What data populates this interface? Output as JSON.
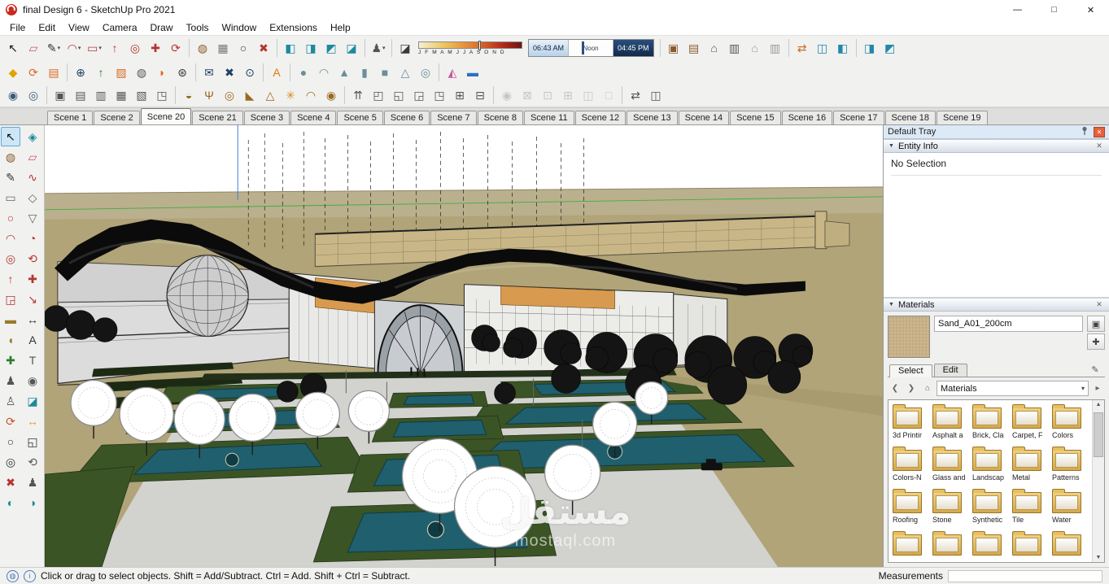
{
  "window": {
    "title": "final Design 6 - SketchUp Pro 2021",
    "controls": {
      "minimize": "—",
      "maximize": "□",
      "close": "✕"
    }
  },
  "menu": {
    "items": [
      "File",
      "Edit",
      "View",
      "Camera",
      "Draw",
      "Tools",
      "Window",
      "Extensions",
      "Help"
    ]
  },
  "toolbars": {
    "shadow": {
      "months": "J F M A M J J A S O N D",
      "time_start": "06:43 AM",
      "time_mid": "Noon",
      "time_end": "04:45 PM"
    },
    "row1a": [
      {
        "n": "select-tool",
        "g": "↖",
        "c": "#111111"
      },
      {
        "n": "eraser-tool",
        "g": "▱",
        "c": "#c4566a"
      },
      {
        "n": "line-tool",
        "g": "✎",
        "c": "#333333",
        "d": 1
      },
      {
        "n": "arc-tool",
        "g": "◠",
        "c": "#b5352f",
        "d": 1
      },
      {
        "n": "rectangle-tool",
        "g": "▭",
        "c": "#b5352f",
        "d": 1
      },
      {
        "n": "push-pull-tool",
        "g": "↑",
        "c": "#b5352f"
      },
      {
        "n": "offset-tool",
        "g": "◎",
        "c": "#b5352f"
      },
      {
        "n": "move-tool",
        "g": "✚",
        "c": "#b5352f"
      },
      {
        "n": "rotate-tool",
        "g": "⟳",
        "c": "#b5352f"
      },
      {
        "sep": 1
      },
      {
        "n": "paint-bucket-tool",
        "g": "◍",
        "c": "#8a5a2a"
      },
      {
        "n": "sandbox-tool",
        "g": "▦",
        "c": "#777777"
      },
      {
        "n": "zoom-tool",
        "g": "○",
        "c": "#333333"
      },
      {
        "n": "axes-tool",
        "g": "✖",
        "c": "#b5352f"
      },
      {
        "sep": 1
      },
      {
        "n": "section-plane-tool",
        "g": "◧",
        "c": "#1b8a9e"
      },
      {
        "n": "section-fill-toggle",
        "g": "◨",
        "c": "#1b8a9e"
      },
      {
        "n": "section-display-toggle",
        "g": "◩",
        "c": "#1b8a9e"
      },
      {
        "n": "section-cuts-toggle",
        "g": "◪",
        "c": "#1b8a9e"
      },
      {
        "sep": 1
      },
      {
        "n": "walk-tool",
        "g": "♟",
        "c": "#555555",
        "d": 1
      },
      {
        "sep": 1
      },
      {
        "n": "shadows-toggle",
        "g": "◪",
        "c": "#3a3a3a"
      }
    ],
    "row1b": [
      {
        "sep": 1
      },
      {
        "n": "components-browser",
        "g": "▣",
        "c": "#8a5a2a"
      },
      {
        "n": "styles-browser",
        "g": "▤",
        "c": "#8a5a2a"
      },
      {
        "n": "model-home",
        "g": "⌂",
        "c": "#555555"
      },
      {
        "n": "print-model",
        "g": "▥",
        "c": "#555555"
      },
      {
        "n": "home-outline",
        "g": "⌂",
        "c": "#999999"
      },
      {
        "n": "print-outline",
        "g": "▥",
        "c": "#999999"
      },
      {
        "sep": 1
      },
      {
        "n": "import-export",
        "g": "⇄",
        "c": "#c96a1f"
      },
      {
        "n": "xray-mode",
        "g": "◫",
        "c": "#2187a8"
      },
      {
        "n": "back-edges-mode",
        "g": "◧",
        "c": "#2187a8"
      },
      {
        "sep": 1
      },
      {
        "n": "wireframe-mode",
        "g": "◨",
        "c": "#2187a8"
      },
      {
        "n": "shaded-mode",
        "g": "◩",
        "c": "#2187a8"
      }
    ],
    "row2": [
      {
        "n": "extension-warehouse",
        "g": "◆",
        "c": "#e0a400"
      },
      {
        "n": "refresh-style",
        "g": "⟳",
        "c": "#d96b1f"
      },
      {
        "n": "layers-manager",
        "g": "▤",
        "c": "#d96b1f"
      },
      {
        "sep": 1
      },
      {
        "n": "add-location",
        "g": "⊕",
        "c": "#1c3f66"
      },
      {
        "n": "send-to-layout",
        "g": "↑",
        "c": "#2d7d2d"
      },
      {
        "n": "photo-textures",
        "g": "▨",
        "c": "#d96b1f"
      },
      {
        "n": "advanced-camera",
        "g": "◍",
        "c": "#555555"
      },
      {
        "n": "solid-tools",
        "g": "◗",
        "c": "#d96b1f"
      },
      {
        "n": "settings-gear",
        "g": "⊛",
        "c": "#333333"
      },
      {
        "sep": 1
      },
      {
        "n": "send-mail",
        "g": "✉",
        "c": "#1c3f66"
      },
      {
        "n": "close-tool",
        "g": "✖",
        "c": "#1c3f66"
      },
      {
        "n": "info-tool",
        "g": "⊙",
        "c": "#1c3f66"
      },
      {
        "sep": 1
      },
      {
        "n": "artisan-tools",
        "g": "A",
        "c": "#e07b10"
      },
      {
        "sep": 1
      },
      {
        "n": "shape-sphere",
        "g": "●",
        "c": "#6a8f98"
      },
      {
        "n": "shape-dome",
        "g": "◠",
        "c": "#6a8f98"
      },
      {
        "n": "shape-cone",
        "g": "▲",
        "c": "#6a8f98"
      },
      {
        "n": "shape-cylinder",
        "g": "▮",
        "c": "#6a8f98"
      },
      {
        "n": "shape-box",
        "g": "■",
        "c": "#6a8f98"
      },
      {
        "n": "shape-pyramid",
        "g": "△",
        "c": "#6a8f98"
      },
      {
        "n": "shape-torus",
        "g": "◎",
        "c": "#6a8f98"
      },
      {
        "sep": 1
      },
      {
        "n": "mirror-tool",
        "g": "◭",
        "c": "#c55a9e"
      },
      {
        "n": "flatten-tool",
        "g": "▬",
        "c": "#2d6fc2"
      }
    ],
    "row3": [
      {
        "n": "round-corner-tool",
        "g": "◉",
        "c": "#3a5a7a"
      },
      {
        "n": "round-edge-tool",
        "g": "◎",
        "c": "#3a5a7a"
      },
      {
        "sep": 1
      },
      {
        "n": "soften-edges-tool",
        "g": "▣",
        "c": "#555555"
      },
      {
        "n": "smooth-mesh-tool",
        "g": "▤",
        "c": "#555555"
      },
      {
        "n": "subdivide-tool",
        "g": "▥",
        "c": "#555555"
      },
      {
        "n": "quad-face-tool",
        "g": "▦",
        "c": "#555555"
      },
      {
        "n": "grid-tool",
        "g": "▧",
        "c": "#555555"
      },
      {
        "n": "box-corner-tool",
        "g": "◳",
        "c": "#555555"
      },
      {
        "sep": 1
      },
      {
        "n": "lamp-tool",
        "g": "◒",
        "c": "#9a6a1f"
      },
      {
        "n": "goblet-tool",
        "g": "Ψ",
        "c": "#9a6a1f"
      },
      {
        "n": "ring-tool",
        "g": "◎",
        "c": "#9a6a1f"
      },
      {
        "n": "triangle-ruler-tool",
        "g": "◣",
        "c": "#9a6a1f"
      },
      {
        "n": "tent-tool",
        "g": "△",
        "c": "#9a6a1f"
      },
      {
        "n": "sun-tool",
        "g": "✳",
        "c": "#d98a1f"
      },
      {
        "n": "dome-tool",
        "g": "◠",
        "c": "#9a6a1f"
      },
      {
        "n": "target-tool",
        "g": "◉",
        "c": "#9a6a1f"
      },
      {
        "sep": 1
      },
      {
        "n": "joint-push-pull",
        "g": "⇈",
        "c": "#555555"
      },
      {
        "n": "cube-cut-top",
        "g": "◰",
        "c": "#555555"
      },
      {
        "n": "cube-cut-bottom",
        "g": "◱",
        "c": "#555555"
      },
      {
        "n": "cube-cut-right",
        "g": "◲",
        "c": "#555555"
      },
      {
        "n": "cube-cut-left",
        "g": "◳",
        "c": "#555555"
      },
      {
        "n": "cube-grid-tool",
        "g": "⊞",
        "c": "#555555"
      },
      {
        "n": "cube-slice-tool",
        "g": "⊟",
        "c": "#555555"
      },
      {
        "sep": 1
      },
      {
        "n": "selection-zoom",
        "g": "◉",
        "c": "#888888",
        "x": 1
      },
      {
        "n": "selection-marquee",
        "g": "⊠",
        "c": "#888888",
        "x": 1
      },
      {
        "n": "selection-fill",
        "g": "⊡",
        "c": "#888888",
        "x": 1
      },
      {
        "n": "selection-grow",
        "g": "⊞",
        "c": "#888888",
        "x": 1
      },
      {
        "n": "selection-pane",
        "g": "◫",
        "c": "#888888",
        "x": 1
      },
      {
        "n": "selection-clear",
        "g": "□",
        "c": "#888888",
        "x": 1
      },
      {
        "sep": 1
      },
      {
        "n": "export-scene",
        "g": "⇄",
        "c": "#555555"
      },
      {
        "n": "import-scene",
        "g": "◫",
        "c": "#555555"
      }
    ]
  },
  "left_toolbar": {
    "icons": [
      {
        "n": "select-tool",
        "g": "↖",
        "c": "#111111",
        "a": 1
      },
      {
        "n": "make-component",
        "g": "◈",
        "c": "#1b8a9e"
      },
      {
        "n": "paint-bucket",
        "g": "◍",
        "c": "#8a5a2a"
      },
      {
        "n": "eraser",
        "g": "▱",
        "c": "#c4566a"
      },
      {
        "n": "line",
        "g": "✎",
        "c": "#333333"
      },
      {
        "n": "freehand",
        "g": "∿",
        "c": "#b5352f"
      },
      {
        "n": "rectangle",
        "g": "▭",
        "c": "#666666"
      },
      {
        "n": "rotated-rectangle",
        "g": "◇",
        "c": "#666666"
      },
      {
        "n": "circle",
        "g": "○",
        "c": "#b5352f"
      },
      {
        "n": "polygon",
        "g": "▽",
        "c": "#666666"
      },
      {
        "n": "arc",
        "g": "◠",
        "c": "#b5352f"
      },
      {
        "n": "pie",
        "g": "◔",
        "c": "#b5352f"
      },
      {
        "n": "offset",
        "g": "◎",
        "c": "#b5352f"
      },
      {
        "n": "rotate",
        "g": "⟲",
        "c": "#b5352f"
      },
      {
        "n": "push-pull",
        "g": "↑",
        "c": "#b5352f"
      },
      {
        "n": "move",
        "g": "✚",
        "c": "#b5352f"
      },
      {
        "n": "scale",
        "g": "◲",
        "c": "#b5352f"
      },
      {
        "n": "follow-me",
        "g": "↘",
        "c": "#b5352f"
      },
      {
        "n": "tape-measure",
        "g": "▬",
        "c": "#9a7a2a"
      },
      {
        "n": "dimension",
        "g": "↔",
        "c": "#333333"
      },
      {
        "n": "protractor",
        "g": "◖",
        "c": "#9a7a2a"
      },
      {
        "n": "text",
        "g": "A",
        "c": "#333333"
      },
      {
        "n": "axes",
        "g": "✚",
        "c": "#2d7d2d"
      },
      {
        "n": "3d-text",
        "g": "T",
        "c": "#555555"
      },
      {
        "n": "position-camera",
        "g": "♟",
        "c": "#555555"
      },
      {
        "n": "look-around",
        "g": "◉",
        "c": "#555555"
      },
      {
        "n": "walk",
        "g": "♙",
        "c": "#555555"
      },
      {
        "n": "section-plane",
        "g": "◪",
        "c": "#1b8a9e"
      },
      {
        "n": "orbit",
        "g": "⟳",
        "c": "#c2542a"
      },
      {
        "n": "pan",
        "g": "↔",
        "c": "#d9a21f"
      },
      {
        "n": "zoom",
        "g": "○",
        "c": "#333333"
      },
      {
        "n": "zoom-window",
        "g": "◱",
        "c": "#333333"
      },
      {
        "n": "zoom-extents",
        "g": "◎",
        "c": "#333333"
      },
      {
        "n": "previous-view",
        "g": "⟲",
        "c": "#555555"
      },
      {
        "n": "cut-scissors",
        "g": "✖",
        "c": "#b5352f"
      },
      {
        "n": "walk-figure",
        "g": "♟",
        "c": "#555555"
      },
      {
        "n": "globe-left",
        "g": "◐",
        "c": "#1b8a9e"
      },
      {
        "n": "globe-right",
        "g": "◑",
        "c": "#1b8a9e"
      }
    ]
  },
  "scene_tabs": {
    "active": "Scene 20",
    "tabs": [
      "Scene 1",
      "Scene 2",
      "Scene 20",
      "Scene 21",
      "Scene 3",
      "Scene 4",
      "Scene 5",
      "Scene 6",
      "Scene 7",
      "Scene 8",
      "Scene 11",
      "Scene 12",
      "Scene 13",
      "Scene 14",
      "Scene 15",
      "Scene 16",
      "Scene 17",
      "Scene 18",
      "Scene 19"
    ]
  },
  "viewport": {
    "watermark_ar": "مستقل",
    "watermark_en": "mostaql.com"
  },
  "tray": {
    "title": "Default Tray",
    "entity_info": {
      "title": "Entity Info",
      "status": "No Selection"
    },
    "materials": {
      "title": "Materials",
      "current": "Sand_A01_200cm",
      "tabs": [
        "Select",
        "Edit"
      ],
      "active_tab": "Select",
      "dropdown": "Materials",
      "folders": [
        "3d Printir",
        "Asphalt a",
        "Brick, Cla",
        "Carpet, F",
        "Colors",
        "Colors-N",
        "Glass and",
        "Landscap",
        "Metal",
        "Patterns",
        "Roofing",
        "Stone",
        "Synthetic",
        "Tile",
        "Water"
      ]
    }
  },
  "status": {
    "message": "Click or drag to select objects. Shift = Add/Subtract. Ctrl = Add. Shift + Ctrl = Subtract.",
    "measurements": "Measurements"
  }
}
